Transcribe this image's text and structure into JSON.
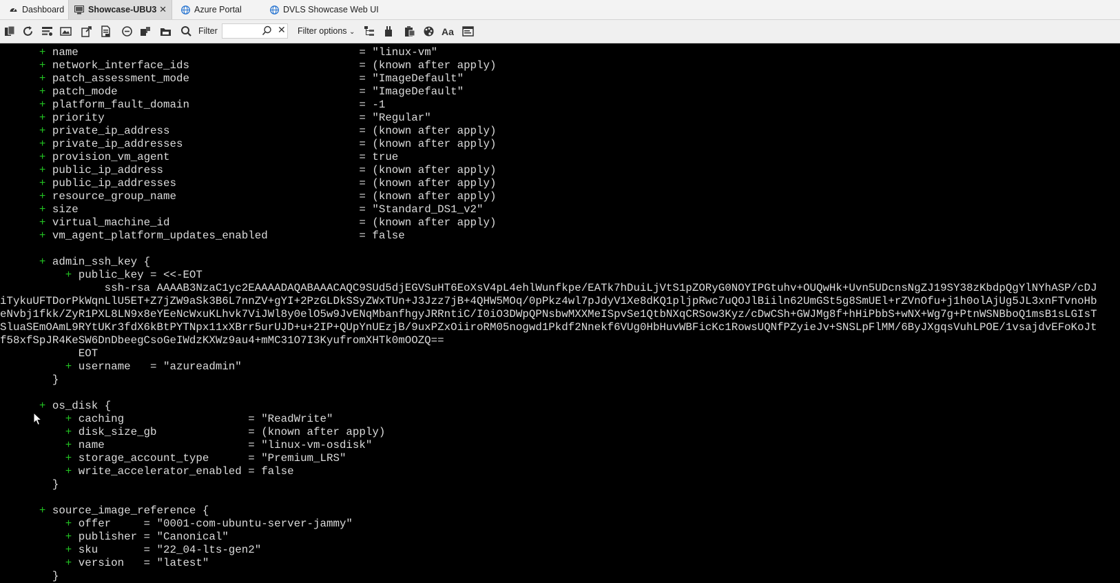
{
  "tabs": [
    {
      "label": "Dashboard",
      "icon": "dashboard-icon"
    },
    {
      "label": "Showcase-UBU3",
      "icon": "terminal-icon",
      "active": true
    },
    {
      "label": "Azure Portal",
      "icon": "globe-icon"
    },
    {
      "label": "DVLS Showcase Web UI",
      "icon": "globe-icon"
    }
  ],
  "toolbar": {
    "filter_label": "Filter",
    "filter_value": "",
    "filter_options_label": "Filter options"
  },
  "colors": {
    "plus": "#22c322",
    "terminal_bg": "#000000",
    "terminal_fg": "#dcdcdc"
  },
  "terminal": {
    "lines": [
      {
        "p": "      ",
        "t": "name                                           = \"linux-vm\""
      },
      {
        "p": "      ",
        "t": "network_interface_ids                          = (known after apply)"
      },
      {
        "p": "      ",
        "t": "patch_assessment_mode                          = \"ImageDefault\""
      },
      {
        "p": "      ",
        "t": "patch_mode                                     = \"ImageDefault\""
      },
      {
        "p": "      ",
        "t": "platform_fault_domain                          = -1"
      },
      {
        "p": "      ",
        "t": "priority                                       = \"Regular\""
      },
      {
        "p": "      ",
        "t": "private_ip_address                             = (known after apply)"
      },
      {
        "p": "      ",
        "t": "private_ip_addresses                           = (known after apply)"
      },
      {
        "p": "      ",
        "t": "provision_vm_agent                             = true"
      },
      {
        "p": "      ",
        "t": "public_ip_address                              = (known after apply)"
      },
      {
        "p": "      ",
        "t": "public_ip_addresses                            = (known after apply)"
      },
      {
        "p": "      ",
        "t": "resource_group_name                            = (known after apply)"
      },
      {
        "p": "      ",
        "t": "size                                           = \"Standard_DS1_v2\""
      },
      {
        "p": "      ",
        "t": "virtual_machine_id                             = (known after apply)"
      },
      {
        "p": "      ",
        "t": "vm_agent_platform_updates_enabled              = false"
      },
      {
        "p": "",
        "t": ""
      },
      {
        "p": "      ",
        "t": "admin_ssh_key {"
      },
      {
        "p": "          ",
        "t": "public_key = <<-EOT"
      },
      {
        "p": "",
        "t": "                ssh-rsa AAAAB3NzaC1yc2EAAAADAQABAAACAQC9SUd5djEGVSuHT6EoXsV4pL4ehlWunfkpe/EATk7hDuiLjVtS1pZORyG0NOYIPGtuhv+OUQwHk+Uvn5UDcnsNgZJ19SY38zKbdpQgYlNYhASP/cDJ"
      },
      {
        "p": "",
        "t": "iTykuUFTDorPkWqnLlU5ET+Z7jZW9aSk3B6L7nnZV+gYI+2PzGLDkSSyZWxTUn+J3Jzz7jB+4QHW5MOq/0pPkz4wl7pJdyV1Xe8dKQ1pljpRwc7uQOJlBiiln62UmGSt5g8SmUEl+rZVnOfu+j1h0olAjUg5JL3xnFTvnoHb"
      },
      {
        "p": "",
        "t": "eNvbj1fkk/ZyR1PXL8LN9x8eYEeNcWxuKLhvk7ViJWl8y0elO5w9JvENqMbanfhgyJRRntiC/I0iO3DWpQPNsbwMXXMeISpvSe1QtbNXqCRSow3Kyz/cDwCSh+GWJMg8f+hHiPbbS+wNX+Wg7g+PtnWSNBboQ1msB1sLGIsT"
      },
      {
        "p": "",
        "t": "SluaSEmOAmL9RYtUKr3fdX6kBtPYTNpx11xXBrr5urUJD+u+2IP+QUpYnUEzjB/9uxPZxOiiroRM05nogwd1Pkdf2Nnekf6VUg0HbHuvWBFicKc1RowsUQNfPZyieJv+SNSLpFlMM/6ByJXgqsVuhLPOE/1vsajdvEFoKoJt"
      },
      {
        "p": "",
        "t": "f58xfSpJR4KeSW6DnDbeegCsoGeIWdzKXWz9au4+mMC31O7I3KyufromXHTk0mOOZQ=="
      },
      {
        "p": "",
        "t": "            EOT"
      },
      {
        "p": "          ",
        "t": "username   = \"azureadmin\""
      },
      {
        "p": "",
        "t": "        }"
      },
      {
        "p": "",
        "t": ""
      },
      {
        "p": "      ",
        "t": "os_disk {"
      },
      {
        "p": "          ",
        "t": "caching                   = \"ReadWrite\""
      },
      {
        "p": "          ",
        "t": "disk_size_gb              = (known after apply)"
      },
      {
        "p": "          ",
        "t": "name                      = \"linux-vm-osdisk\""
      },
      {
        "p": "          ",
        "t": "storage_account_type      = \"Premium_LRS\""
      },
      {
        "p": "          ",
        "t": "write_accelerator_enabled = false"
      },
      {
        "p": "",
        "t": "        }"
      },
      {
        "p": "",
        "t": ""
      },
      {
        "p": "      ",
        "t": "source_image_reference {"
      },
      {
        "p": "          ",
        "t": "offer     = \"0001-com-ubuntu-server-jammy\""
      },
      {
        "p": "          ",
        "t": "publisher = \"Canonical\""
      },
      {
        "p": "          ",
        "t": "sku       = \"22_04-lts-gen2\""
      },
      {
        "p": "          ",
        "t": "version   = \"latest\""
      },
      {
        "p": "",
        "t": "        }"
      }
    ]
  }
}
